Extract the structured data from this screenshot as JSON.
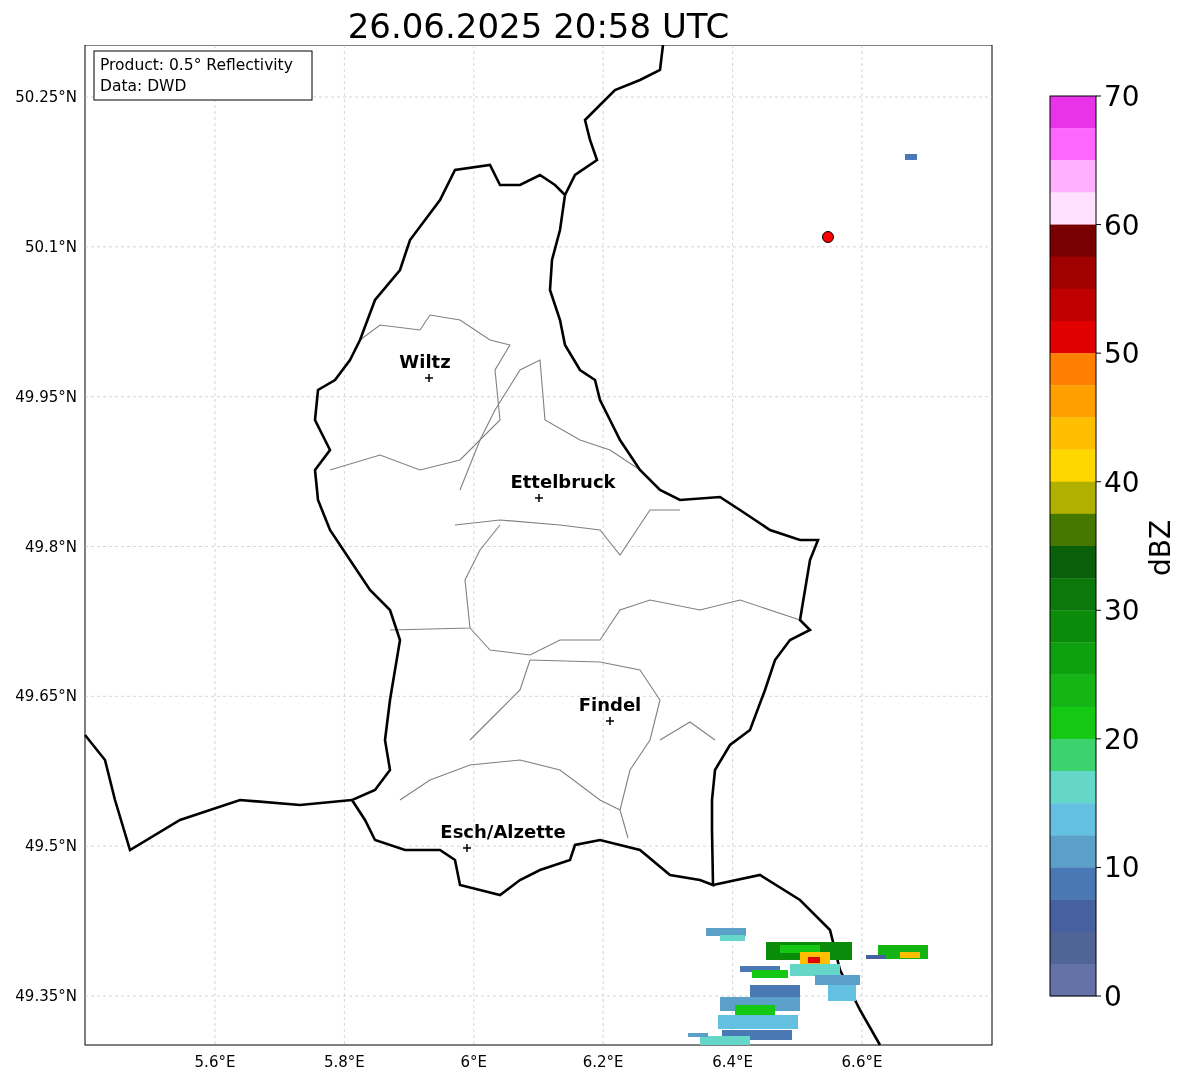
{
  "title": "26.06.2025 20:58 UTC",
  "info_box": [
    "Product: 0.5° Reflectivity",
    "Data: DWD"
  ],
  "lat_ticks": [
    "50.25°N",
    "50.1°N",
    "49.95°N",
    "49.8°N",
    "49.65°N",
    "49.5°N",
    "49.35°N"
  ],
  "lon_ticks": [
    "5.6°E",
    "5.8°E",
    "6°E",
    "6.2°E",
    "6.4°E",
    "6.6°E"
  ],
  "cities": [
    {
      "name": "Wiltz"
    },
    {
      "name": "Ettelbruck"
    },
    {
      "name": "Findel"
    },
    {
      "name": "Esch/Alzette"
    }
  ],
  "colorbar": {
    "label": "dBZ",
    "ticks": [
      "70",
      "60",
      "50",
      "40",
      "30",
      "20",
      "10",
      "0"
    ],
    "segments": [
      {
        "color": "#e833e8"
      },
      {
        "color": "#ff66ff"
      },
      {
        "color": "#ffb0ff"
      },
      {
        "color": "#ffe0ff"
      },
      {
        "color": "#780000"
      },
      {
        "color": "#a00000"
      },
      {
        "color": "#c00000"
      },
      {
        "color": "#e00000"
      },
      {
        "color": "#ff8000"
      },
      {
        "color": "#ff9f00"
      },
      {
        "color": "#ffbf00"
      },
      {
        "color": "#ffd700"
      },
      {
        "color": "#b0b000"
      },
      {
        "color": "#467800"
      },
      {
        "color": "#0a5f0a"
      },
      {
        "color": "#0a780a"
      },
      {
        "color": "#0a8c0a"
      },
      {
        "color": "#0fa00f"
      },
      {
        "color": "#14b414"
      },
      {
        "color": "#14c814"
      },
      {
        "color": "#3cd26e"
      },
      {
        "color": "#64d7c8"
      },
      {
        "color": "#64c0e0"
      },
      {
        "color": "#5aa0c8"
      },
      {
        "color": "#4a78b4"
      },
      {
        "color": "#4660a0"
      },
      {
        "color": "#506496"
      },
      {
        "color": "#6472a8"
      }
    ]
  }
}
